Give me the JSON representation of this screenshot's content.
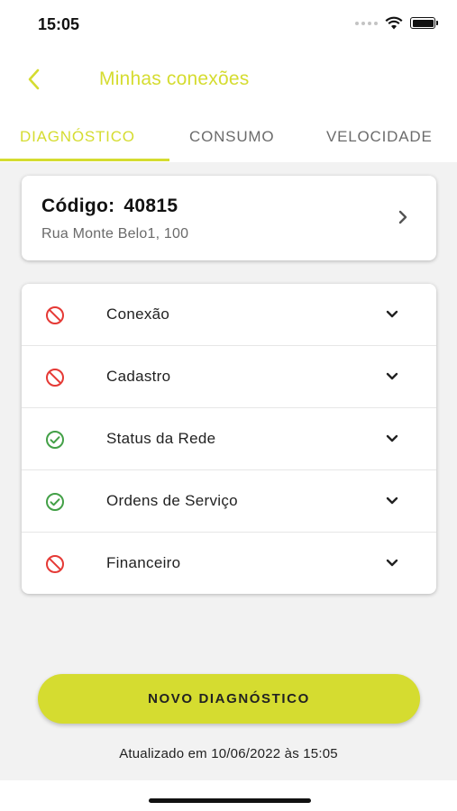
{
  "status_bar": {
    "time": "15:05"
  },
  "header": {
    "title": "Minhas conexões",
    "back_icon": "chevron-left-icon"
  },
  "tabs": [
    {
      "label": "DIAGNÓSTICO",
      "active": true
    },
    {
      "label": "CONSUMO",
      "active": false
    },
    {
      "label": "VELOCIDADE",
      "active": false
    }
  ],
  "connection": {
    "code_label": "Código:",
    "code_value": "40815",
    "address": "Rua Monte Belo1, 100"
  },
  "diagnostics": [
    {
      "label": "Conexão",
      "status": "error",
      "icon": "block-icon"
    },
    {
      "label": "Cadastro",
      "status": "error",
      "icon": "block-icon"
    },
    {
      "label": "Status da Rede",
      "status": "ok",
      "icon": "check-circle-icon"
    },
    {
      "label": "Ordens de Serviço",
      "status": "ok",
      "icon": "check-circle-icon"
    },
    {
      "label": "Financeiro",
      "status": "error",
      "icon": "block-icon"
    }
  ],
  "actions": {
    "new_diagnostic": "NOVO DIAGNÓSTICO"
  },
  "footer": {
    "updated_text": "Atualizado em 10/06/2022 às 15:05"
  },
  "colors": {
    "accent": "#d5dc30",
    "error": "#e53935",
    "ok": "#43a047",
    "tab_inactive": "#6b6b6b"
  }
}
